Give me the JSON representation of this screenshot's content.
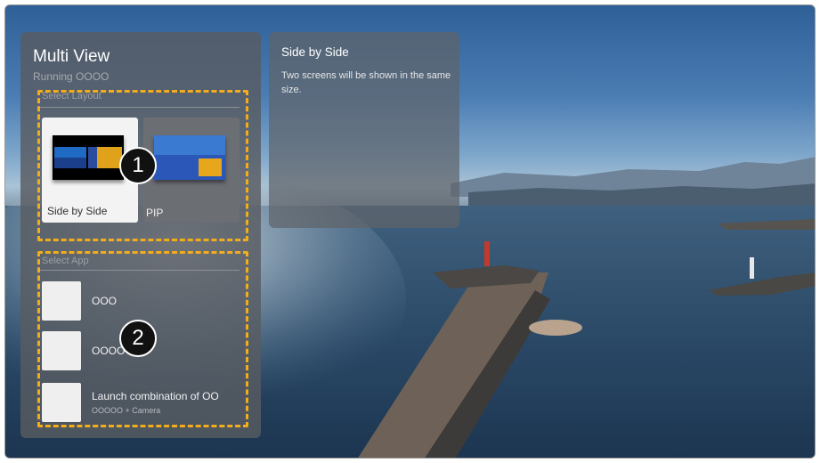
{
  "panel": {
    "title": "Multi View",
    "subtitle": "Running OOOO",
    "layout_section_label": "Select Layout",
    "app_section_label": "Select App"
  },
  "layouts": [
    {
      "label": "Side by Side",
      "selected": true
    },
    {
      "label": "PIP",
      "selected": false
    }
  ],
  "apps": [
    {
      "name": "OOO",
      "meta": ""
    },
    {
      "name": "OOOO",
      "meta": ""
    },
    {
      "name": "Launch combination of OO",
      "meta": "OOOOO + Camera"
    }
  ],
  "info": {
    "title": "Side by Side",
    "description": "Two screens will be shown in the same size."
  },
  "markers": [
    "1",
    "2"
  ],
  "colors": {
    "callout_dash": "#f2ad1d",
    "panel_bg": "#585c62",
    "selected_card": "#f3f3f3"
  }
}
